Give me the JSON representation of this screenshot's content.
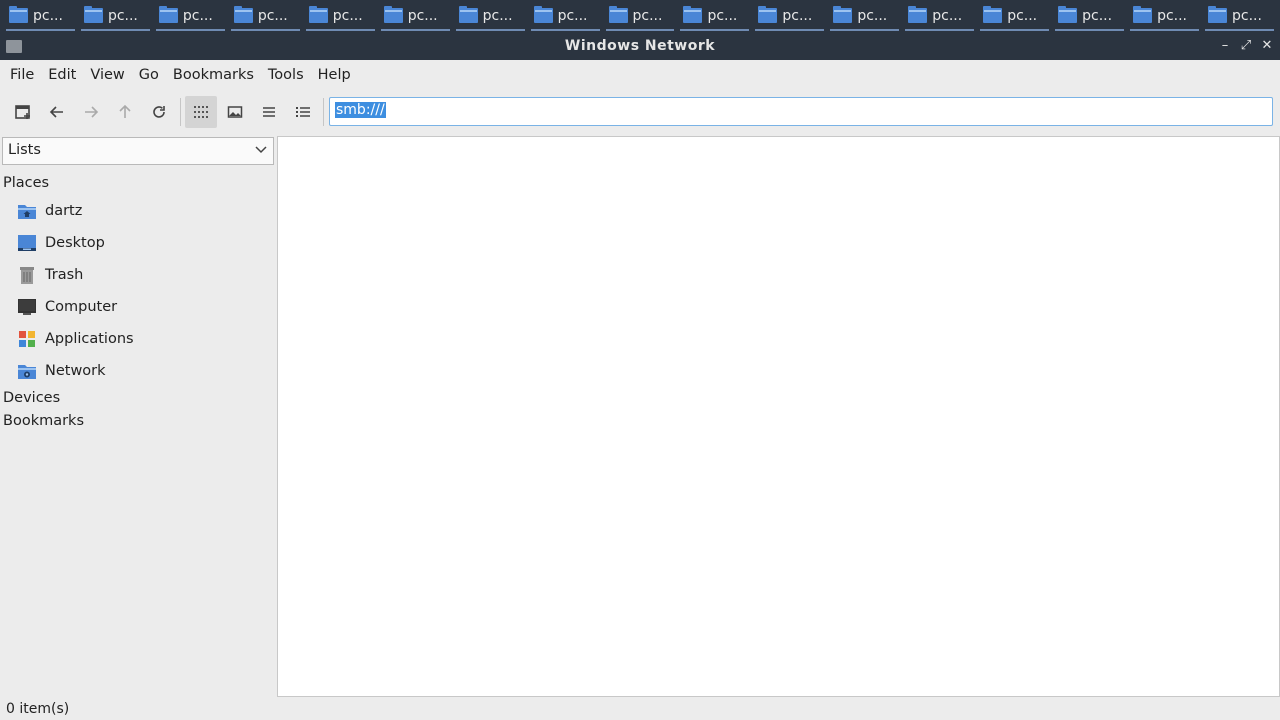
{
  "taskbar": {
    "buttons": [
      "pc...",
      "pc...",
      "pc...",
      "pc...",
      "pc...",
      "pc...",
      "pc...",
      "pc...",
      "pc...",
      "pc...",
      "pc...",
      "pc...",
      "pc...",
      "pc...",
      "pc...",
      "pc...",
      "pc..."
    ]
  },
  "window": {
    "title": "Windows Network",
    "controls": {
      "minimize": "–",
      "maximize": "⤢",
      "close": "✕"
    }
  },
  "menubar": {
    "items": [
      "File",
      "Edit",
      "View",
      "Go",
      "Bookmarks",
      "Tools",
      "Help"
    ]
  },
  "toolbar": {
    "location": "smb:///",
    "view_mode_active": "icon-view",
    "icons": [
      "new-tab-icon",
      "back-icon",
      "forward-icon",
      "up-icon",
      "reload-icon",
      "icon-view-icon",
      "compact-view-icon",
      "detailed-list-icon",
      "list-view-icon"
    ]
  },
  "sidebar": {
    "selector": "Lists",
    "places_title": "Places",
    "places": [
      {
        "label": "dartz",
        "icon": "home-folder-icon"
      },
      {
        "label": "Desktop",
        "icon": "desktop-icon"
      },
      {
        "label": "Trash",
        "icon": "trash-icon"
      },
      {
        "label": "Computer",
        "icon": "computer-icon"
      },
      {
        "label": "Applications",
        "icon": "applications-icon"
      },
      {
        "label": "Network",
        "icon": "network-folder-icon"
      }
    ],
    "devices_title": "Devices",
    "bookmarks_title": "Bookmarks"
  },
  "status": {
    "text": "0 item(s)"
  },
  "colors": {
    "panel_bg": "#2b3440",
    "folder_blue": "#4a86d6",
    "selection": "#3d8ee0"
  }
}
